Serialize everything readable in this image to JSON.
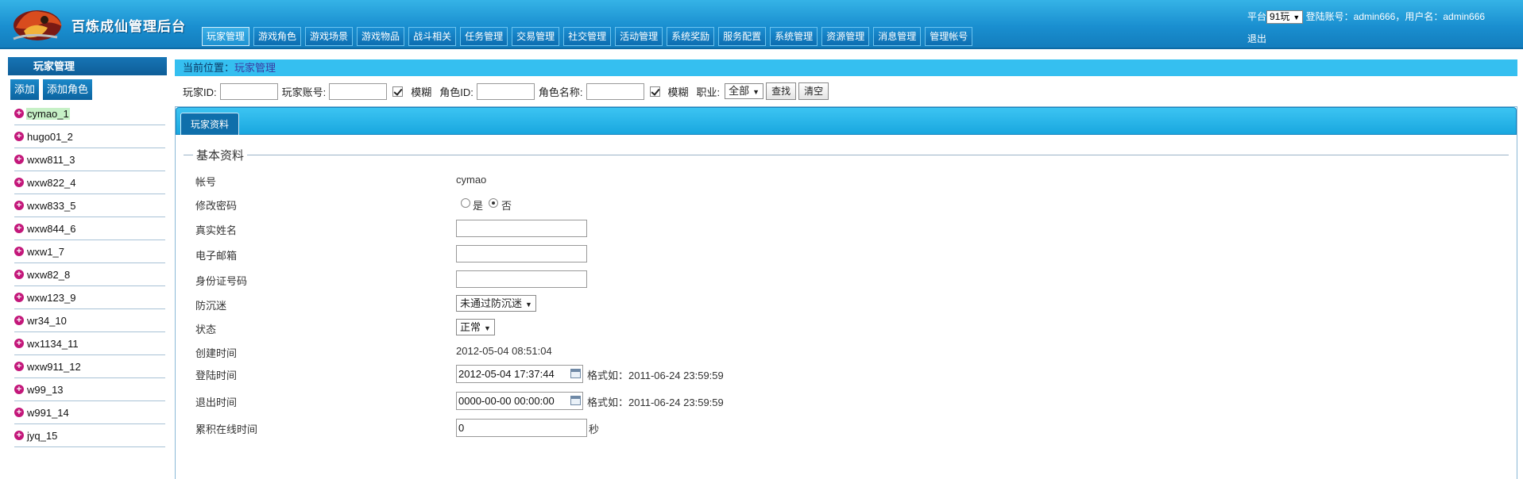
{
  "app": {
    "title": "百炼成仙管理后台"
  },
  "nav": {
    "tabs": [
      "玩家管理",
      "游戏角色",
      "游戏场景",
      "游戏物品",
      "战斗相关",
      "任务管理",
      "交易管理",
      "社交管理",
      "活动管理",
      "系统奖励",
      "服务配置",
      "系统管理",
      "资源管理",
      "消息管理",
      "管理帐号"
    ],
    "active": 0
  },
  "topright": {
    "platform_label": "平台",
    "platform_value": "91玩",
    "account_text": "登陆账号：admin666，用户名：admin666",
    "logout_label": "退出"
  },
  "sidebar": {
    "title": "玩家管理",
    "add_label": "添加",
    "add_role_label": "添加角色",
    "players": [
      "cymao_1",
      "hugo01_2",
      "wxw811_3",
      "wxw822_4",
      "wxw833_5",
      "wxw844_6",
      "wxw1_7",
      "wxw82_8",
      "wxw123_9",
      "wr34_10",
      "wx1134_11",
      "wxw911_12",
      "w99_13",
      "w991_14",
      "jyq_15"
    ],
    "selected": 0
  },
  "breadcrumb": {
    "prefix": "当前位置：",
    "current": "玩家管理"
  },
  "search": {
    "player_id_label": "玩家ID:",
    "player_account_label": "玩家账号:",
    "fuzzy_label": "模糊",
    "role_id_label": "角色ID:",
    "role_name_label": "角色名称:",
    "fuzzy2_label": "模糊",
    "job_label": "职业:",
    "job_value": "全部",
    "find_label": "查找",
    "clear_label": "清空"
  },
  "panel": {
    "tab_label": "玩家资料",
    "legend": "基本资料",
    "fields": {
      "account_label": "帐号",
      "account_value": "cymao",
      "change_pwd_label": "修改密码",
      "yes_label": "是",
      "no_label": "否",
      "realname_label": "真实姓名",
      "email_label": "电子邮箱",
      "idcard_label": "身份证号码",
      "antiaddict_label": "防沉迷",
      "antiaddict_value": "未通过防沉迷",
      "status_label": "状态",
      "status_value": "正常",
      "created_label": "创建时间",
      "created_value": "2012-05-04 08:51:04",
      "login_label": "登陆时间",
      "login_value": "2012-05-04 17:37:44",
      "login_hint": "格式如：2011-06-24 23:59:59",
      "logout_label": "退出时间",
      "logout_value": "0000-00-00 00:00:00",
      "logout_hint": "格式如：2011-06-24 23:59:59",
      "online_label": "累积在线时间",
      "online_value": "0",
      "online_unit": "秒"
    }
  }
}
